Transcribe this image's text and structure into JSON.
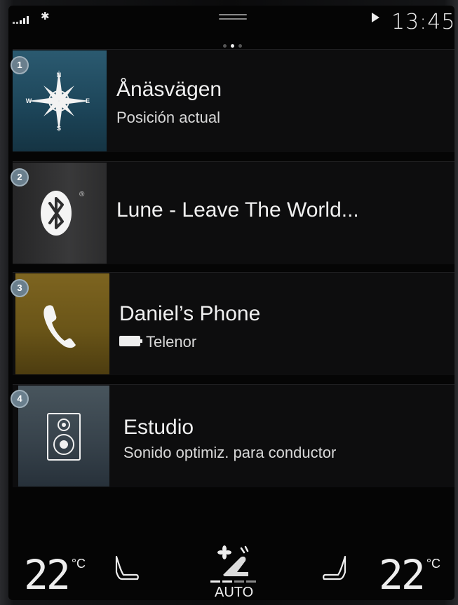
{
  "status": {
    "bluetooth_icon": "bluetooth-icon",
    "media_icon": "play-icon",
    "time": "13:45",
    "page_count": 3,
    "active_page": 2
  },
  "tiles": [
    {
      "badge": "1",
      "icon": "compass-icon",
      "title": "Ånäsvägen",
      "subtitle": "Posición actual",
      "compass": {
        "n": "N",
        "s": "S",
        "e": "E",
        "w": "W"
      }
    },
    {
      "badge": "2",
      "icon": "bluetooth-icon",
      "title": "Lune - Leave The World...",
      "registered_mark": "®"
    },
    {
      "badge": "3",
      "icon": "phone-icon",
      "title": "Daniel’s Phone",
      "subtitle": "Telenor",
      "subtitle_icon": "battery-icon"
    },
    {
      "badge": "4",
      "icon": "speaker-icon",
      "title": "Estudio",
      "subtitle": "Sonido optimiz. para conductor"
    }
  ],
  "climate": {
    "left_temp": "22",
    "left_unit": "°C",
    "right_temp": "22",
    "right_unit": "°C",
    "auto_label": "AUTO",
    "left_seat_icon": "seat-heater-icon",
    "right_seat_icon": "seat-heater-icon",
    "fan_icon": "fan-icon"
  },
  "colors": {
    "nav_tile": "#1c4458",
    "media_tile": "#39393a",
    "phone_tile": "#6a5518",
    "audio_tile": "#36414a",
    "badge": "#6a7f8d"
  }
}
